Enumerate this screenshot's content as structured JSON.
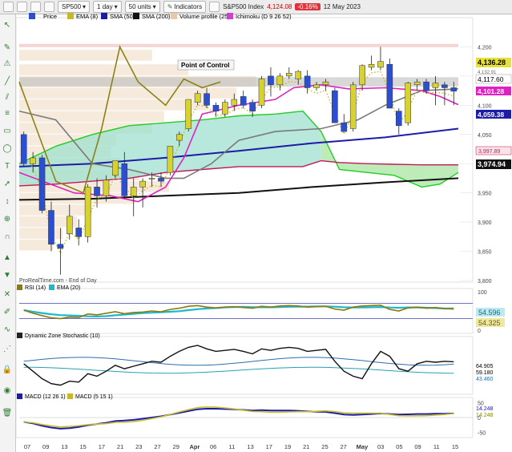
{
  "toolbar": {
    "symbol": "SP500",
    "timeframe": "1 day",
    "units": "50 units",
    "indicators_label": "Indicators",
    "instrument": "S&P500 Index",
    "price": "4,124.08",
    "change": "-0.16%",
    "date": "12 May 2023"
  },
  "legend_main": {
    "price": "Price",
    "ema": "EMA (8)",
    "sma50": "SMA (50)",
    "sma200": "SMA (200)",
    "vp": "Volume profile (25)",
    "ichimoku": "Ichimoku (D 9 26 52)"
  },
  "poc_label": "Point of Control",
  "watermark": "ProRealTime.com - End of Day",
  "price_axis": [
    "4,200",
    "4,150",
    "4,100",
    "4,050",
    "4,000",
    "3,950",
    "3,900",
    "3,850",
    "3,800"
  ],
  "price_badges": {
    "last": "4,136.28",
    "small": "4,132.91",
    "ema": "4,117.60",
    "kijun": "4,101.28",
    "sma50": "4,059.38",
    "cloud": "3,997.89",
    "sma200": "3,974.94"
  },
  "rsi": {
    "label": "RSI (14)",
    "ema_label": "EMA (20)",
    "value": "54.596",
    "ema_value": "54.325",
    "axis": [
      "100",
      "50",
      "0"
    ]
  },
  "stoch": {
    "label": "Dynamic Zone Stochastic (10)",
    "v1": "64.905",
    "v2": "59.180",
    "v3": "43.460"
  },
  "macd": {
    "label1": "MACD (12 26 1)",
    "label2": "MACD (5 15 1)",
    "v1": "14.248",
    "v2": "14.248",
    "axis": [
      "50",
      "0",
      "-50"
    ]
  },
  "x_axis": [
    "07",
    "09",
    "13",
    "15",
    "17",
    "21",
    "23",
    "27",
    "29",
    "Apr",
    "06",
    "11",
    "13",
    "17",
    "19",
    "21",
    "25",
    "27",
    "May",
    "03",
    "05",
    "09",
    "11",
    "15"
  ],
  "colors": {
    "bull": "#d8d230",
    "bear": "#2c4fd2",
    "sma50": "#1c1ca8",
    "sma200": "#111111",
    "ema8": "#c8b824",
    "tenkan": "#e020c0",
    "kijun": "#7a7a7a",
    "chikou": "#8a8218",
    "span_green": "#22cc22",
    "span_red": "#c0185a",
    "rsi": "#8a7a10",
    "rsi_ema": "#20b8c8"
  },
  "chart_data": {
    "type": "candlestick",
    "ylim": [
      3800,
      4250
    ],
    "x": [
      "03-07",
      "03-08",
      "03-09",
      "03-10",
      "03-13",
      "03-14",
      "03-15",
      "03-16",
      "03-17",
      "03-20",
      "03-21",
      "03-22",
      "03-23",
      "03-24",
      "03-27",
      "03-28",
      "03-29",
      "03-30",
      "03-31",
      "04-03",
      "04-04",
      "04-05",
      "04-06",
      "04-10",
      "04-11",
      "04-12",
      "04-13",
      "04-14",
      "04-17",
      "04-18",
      "04-19",
      "04-20",
      "04-21",
      "04-24",
      "04-25",
      "04-26",
      "04-27",
      "04-28",
      "05-01",
      "05-02",
      "05-03",
      "05-04",
      "05-05",
      "05-08",
      "05-09",
      "05-10",
      "05-11",
      "05-12"
    ],
    "ohlc": [
      [
        4050,
        4055,
        3995,
        4000
      ],
      [
        4000,
        4020,
        3985,
        4010
      ],
      [
        4010,
        4015,
        3915,
        3920
      ],
      [
        3920,
        3935,
        3850,
        3862
      ],
      [
        3862,
        3890,
        3810,
        3855
      ],
      [
        3880,
        3930,
        3870,
        3910
      ],
      [
        3890,
        3905,
        3860,
        3875
      ],
      [
        3875,
        3965,
        3865,
        3960
      ],
      [
        3960,
        3975,
        3925,
        3945
      ],
      [
        3945,
        3980,
        3935,
        3972
      ],
      [
        3980,
        4005,
        3975,
        4005
      ],
      [
        4000,
        4020,
        3940,
        3945
      ],
      [
        3945,
        3975,
        3910,
        3960
      ],
      [
        3960,
        3975,
        3925,
        3970
      ],
      [
        3975,
        3985,
        3960,
        3975
      ],
      [
        3975,
        3985,
        3960,
        3970
      ],
      [
        3985,
        4030,
        3980,
        4030
      ],
      [
        4040,
        4055,
        4030,
        4050
      ],
      [
        4060,
        4110,
        4055,
        4110
      ],
      [
        4105,
        4125,
        4100,
        4120
      ],
      [
        4120,
        4130,
        4095,
        4100
      ],
      [
        4100,
        4105,
        4080,
        4090
      ],
      [
        4085,
        4110,
        4080,
        4105
      ],
      [
        4100,
        4120,
        4090,
        4110
      ],
      [
        4115,
        4125,
        4095,
        4100
      ],
      [
        4105,
        4110,
        4080,
        4090
      ],
      [
        4100,
        4150,
        4095,
        4145
      ],
      [
        4150,
        4165,
        4115,
        4135
      ],
      [
        4135,
        4155,
        4125,
        4150
      ],
      [
        4150,
        4165,
        4145,
        4155
      ],
      [
        4145,
        4160,
        4135,
        4158
      ],
      [
        4150,
        4160,
        4120,
        4130
      ],
      [
        4130,
        4140,
        4125,
        4135
      ],
      [
        4135,
        4145,
        4125,
        4140
      ],
      [
        4125,
        4130,
        4070,
        4070
      ],
      [
        4070,
        4085,
        4055,
        4055
      ],
      [
        4060,
        4140,
        4055,
        4135
      ],
      [
        4135,
        4170,
        4125,
        4168
      ],
      [
        4165,
        4185,
        4160,
        4170
      ],
      [
        4165,
        4200,
        4160,
        4175
      ],
      [
        4170,
        4180,
        4095,
        4095
      ],
      [
        4090,
        4095,
        4050,
        4065
      ],
      [
        4070,
        4140,
        4065,
        4138
      ],
      [
        4135,
        4145,
        4125,
        4140
      ],
      [
        4140,
        4145,
        4120,
        4125
      ],
      [
        4130,
        4150,
        4100,
        4138
      ],
      [
        4135,
        4140,
        4100,
        4130
      ],
      [
        4130,
        4140,
        4100,
        4124
      ]
    ]
  }
}
